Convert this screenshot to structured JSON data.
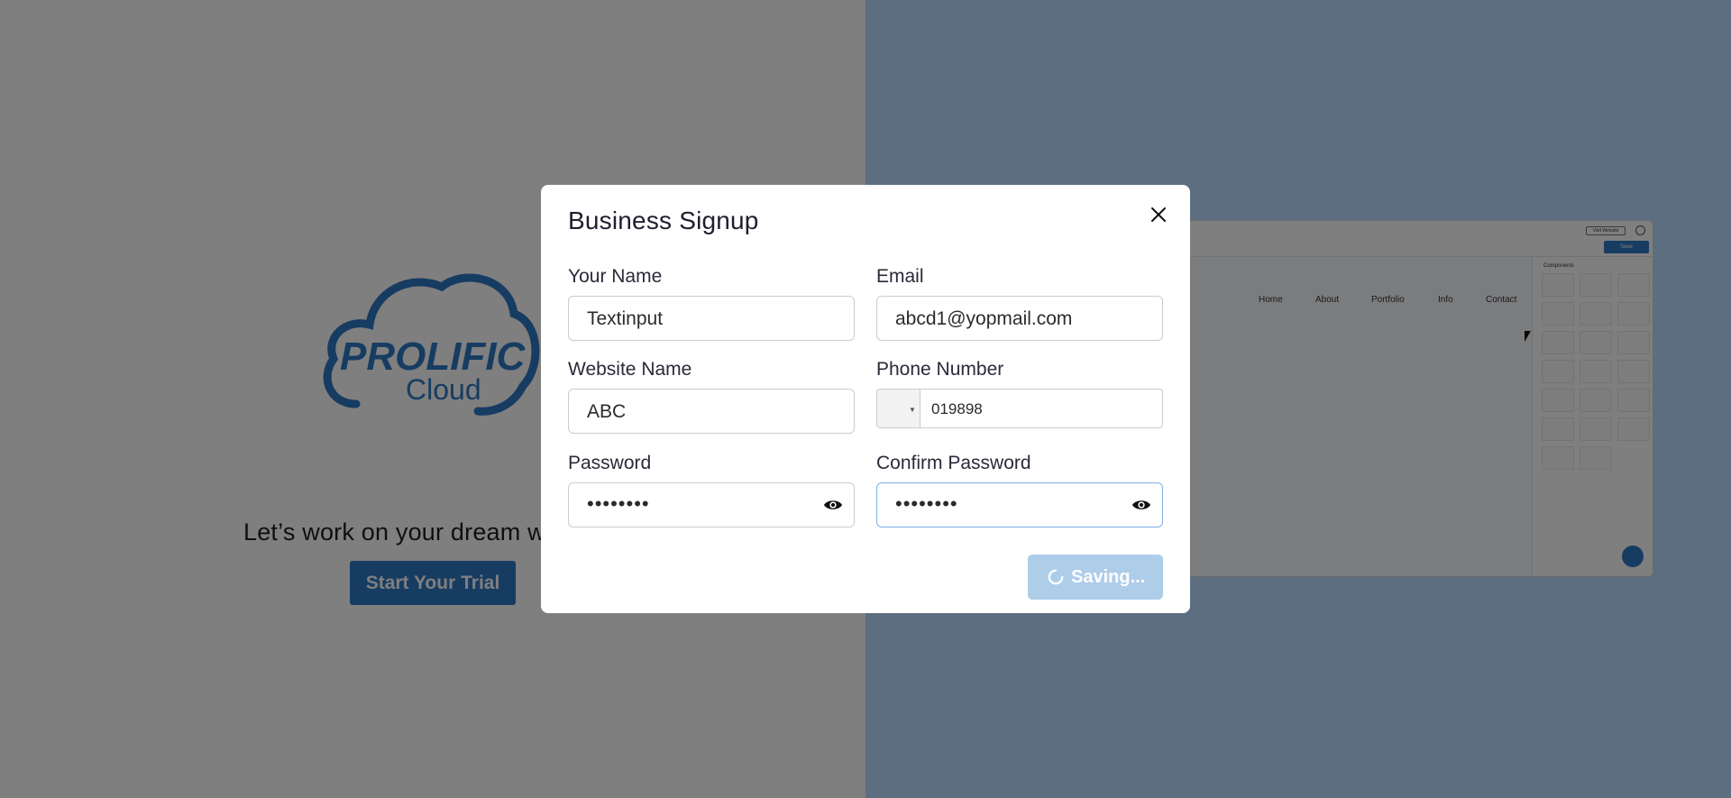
{
  "background": {
    "logo": {
      "line1": "PROLIFIC",
      "line2": "Cloud"
    },
    "tagline": "Let’s work on your dream w",
    "trial_button": "Start Your Trial",
    "preview": {
      "visit_label": "Visit Website",
      "save_label": "Save",
      "nav": [
        "Home",
        "About",
        "Portfolio",
        "Info",
        "Contact"
      ],
      "panel_title": "Components"
    }
  },
  "modal": {
    "title": "Business Signup",
    "fields": {
      "your_name": {
        "label": "Your Name",
        "value": "Textinput"
      },
      "email": {
        "label": "Email",
        "value": "abcd1@yopmail.com"
      },
      "website_name": {
        "label": "Website Name",
        "value": "ABC"
      },
      "phone_number": {
        "label": "Phone Number",
        "value": "019898"
      },
      "password": {
        "label": "Password",
        "value": "••••••••"
      },
      "confirm_password": {
        "label": "Confirm Password",
        "value": "••••••••"
      }
    },
    "submit": {
      "label": "Saving...",
      "state": "loading"
    }
  },
  "colors": {
    "brand_blue": "#2f78c4",
    "disabled_button": "#aecde9",
    "overlay": "rgba(0,0,0,0.5)"
  },
  "icons": {
    "close": "close-icon",
    "password_toggle": "eye-icon",
    "spinner": "spinner-icon"
  }
}
